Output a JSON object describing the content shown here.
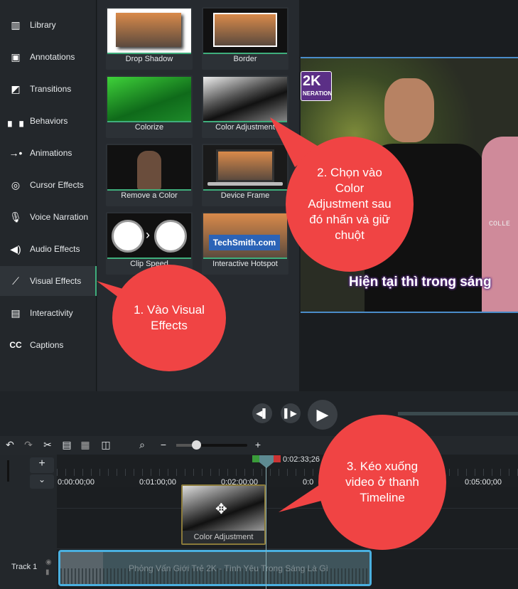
{
  "sidebar": {
    "items": [
      {
        "label": "Library",
        "icon": "library-icon"
      },
      {
        "label": "Annotations",
        "icon": "annotations-icon"
      },
      {
        "label": "Transitions",
        "icon": "transitions-icon"
      },
      {
        "label": "Behaviors",
        "icon": "behaviors-icon"
      },
      {
        "label": "Animations",
        "icon": "animations-icon"
      },
      {
        "label": "Cursor Effects",
        "icon": "cursor-effects-icon"
      },
      {
        "label": "Voice Narration",
        "icon": "microphone-icon"
      },
      {
        "label": "Audio Effects",
        "icon": "speaker-icon"
      },
      {
        "label": "Visual Effects",
        "icon": "magic-wand-icon",
        "active": true
      },
      {
        "label": "Interactivity",
        "icon": "interactivity-icon"
      },
      {
        "label": "Captions",
        "icon": "cc-icon"
      }
    ]
  },
  "effects": [
    {
      "label": "Drop Shadow"
    },
    {
      "label": "Border"
    },
    {
      "label": "Colorize"
    },
    {
      "label": "Color Adjustment"
    },
    {
      "label": "Remove a Color"
    },
    {
      "label": "Device Frame"
    },
    {
      "label": "Clip Speed"
    },
    {
      "label": "Interactive Hotspot",
      "thumb_text": "TechSmith.com"
    }
  ],
  "video": {
    "logo_text": "2K",
    "logo_sub": "NERATION",
    "subtitle": "Hiện tại thì trong sáng",
    "shirt_text": "COLLE"
  },
  "callouts": {
    "c1": "1. Vào Visual Effects",
    "c2": "2. Chọn vào Color Adjustment sau đó nhấn và giữ chuột",
    "c3": "3. Kéo xuống video ở thanh Timeline"
  },
  "timeline": {
    "playhead_time": "0:02:33;26",
    "ticks": [
      "0:00:00;00",
      "0:01:00;00",
      "0:02:00;00",
      "0:0",
      "0:05:00;00"
    ],
    "dragged_clip": "Color Adjustment",
    "track_label": "Track 1",
    "track_clip_title": "Phỏng Vấn Giới Trẻ 2K - Tình Yêu Trong Sáng Là Gì"
  },
  "colors": {
    "accent": "#3fae7c",
    "callout": "#f04444",
    "selection": "#4ab0e0"
  }
}
